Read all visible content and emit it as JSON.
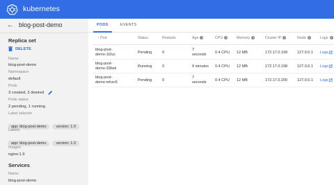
{
  "app": {
    "brand": "kubernetes"
  },
  "header": {
    "back_icon": "arrow-left-icon",
    "title": "blog-post-demo"
  },
  "sidebar": {
    "replica_set_title": "Replica set",
    "delete_label": "DELETE",
    "name_label": "Name",
    "name_value": "blog-post-demo",
    "namespace_label": "Namespace",
    "namespace_value": "default",
    "pods_label": "Pods",
    "pods_value": "3 created, 3 desired",
    "pods_status_label": "Pods status",
    "pods_status_value": "2 pending, 1 running",
    "label_selector_label": "Label selector",
    "label_selector_chips": [
      "app: blog-post-demo",
      "version: 1.0"
    ],
    "labels_label": "Labels",
    "labels_chips": [
      "app: blog-post-demo",
      "version: 1.0"
    ],
    "images_label": "Images",
    "images_value": "nginx:1.9",
    "services_title": "Services",
    "services_name_label": "Name",
    "services_name_value": "blog-post-demo"
  },
  "tabs": [
    {
      "label": "PODS",
      "active": true
    },
    {
      "label": "EVENTS",
      "active": false
    }
  ],
  "table": {
    "headers": {
      "pod": "Pod",
      "status": "Status",
      "restarts": "Restarts",
      "age": "Age",
      "cpu": "CPU",
      "memory": "Memory",
      "cluster_ip": "Cluster IP",
      "node": "Node",
      "logs": "Logs"
    },
    "rows": [
      {
        "pod": "blog-post-demo-1t2uc",
        "pod_l1": "blog-post-",
        "pod_l2": "demo-1t2uc",
        "status": "Pending",
        "restarts": "0",
        "age_l1": "7",
        "age_l2": "seconds",
        "cpu": "0.4 CPU",
        "memory": "12 MB",
        "cluster_ip": "172.17.0.199",
        "node": "127.0.0.1",
        "logs": "Logs"
      },
      {
        "pod": "blog-post-demo-33bzk",
        "pod_l1": "blog-post-",
        "pod_l2": "demo-33bzk",
        "status": "Running",
        "restarts": "0",
        "age_l1": "9 minutes",
        "age_l2": "",
        "cpu": "0.4 CPU",
        "memory": "12 MB",
        "cluster_ip": "172.17.0.198",
        "node": "127.0.0.1",
        "logs": "Logs"
      },
      {
        "pod": "blog-post-demo-mhzc6",
        "pod_l1": "blog-post-",
        "pod_l2": "demo-mhzc6",
        "status": "Pending",
        "restarts": "0",
        "age_l1": "7",
        "age_l2": "seconds",
        "cpu": "0.4 CPU",
        "memory": "12 MB",
        "cluster_ip": "172.17.0.200",
        "node": "127.0.0.1",
        "logs": "Logs"
      }
    ]
  },
  "colors": {
    "brand_blue": "#326de6"
  }
}
